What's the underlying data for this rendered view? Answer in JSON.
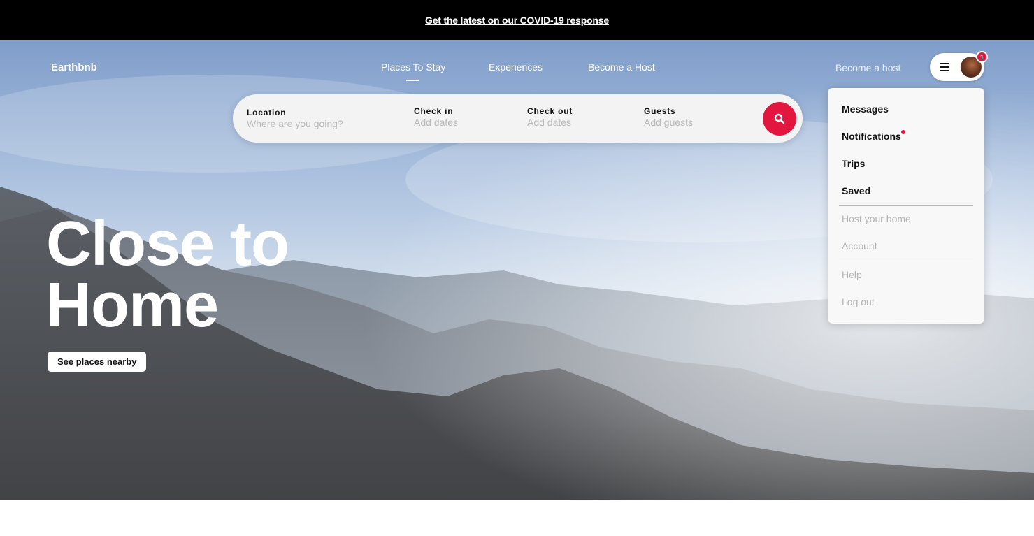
{
  "banner": {
    "text": "Get the latest on our COVID-19 response"
  },
  "header": {
    "logo": "Earthbnb",
    "nav": [
      {
        "label": "Places To Stay",
        "active": true
      },
      {
        "label": "Experiences",
        "active": false
      },
      {
        "label": "Become a Host",
        "active": false
      }
    ],
    "become_host": "Become a host",
    "notification_count": "1"
  },
  "search": {
    "location": {
      "label": "Location",
      "placeholder": "Where are you going?"
    },
    "check_in": {
      "label": "Check in",
      "placeholder": "Add dates"
    },
    "check_out": {
      "label": "Check out",
      "placeholder": "Add dates"
    },
    "guests": {
      "label": "Guests",
      "placeholder": "Add guests"
    }
  },
  "hero": {
    "headline_line1": "Close to",
    "headline_line2": "Home",
    "cta": "See places nearby"
  },
  "menu": {
    "messages": "Messages",
    "notifications": "Notifications",
    "trips": "Trips",
    "saved": "Saved",
    "host_your_home": "Host your home",
    "account": "Account",
    "help": "Help",
    "log_out": "Log out"
  },
  "colors": {
    "accent": "#e3163f",
    "banner_bg": "#000000"
  }
}
